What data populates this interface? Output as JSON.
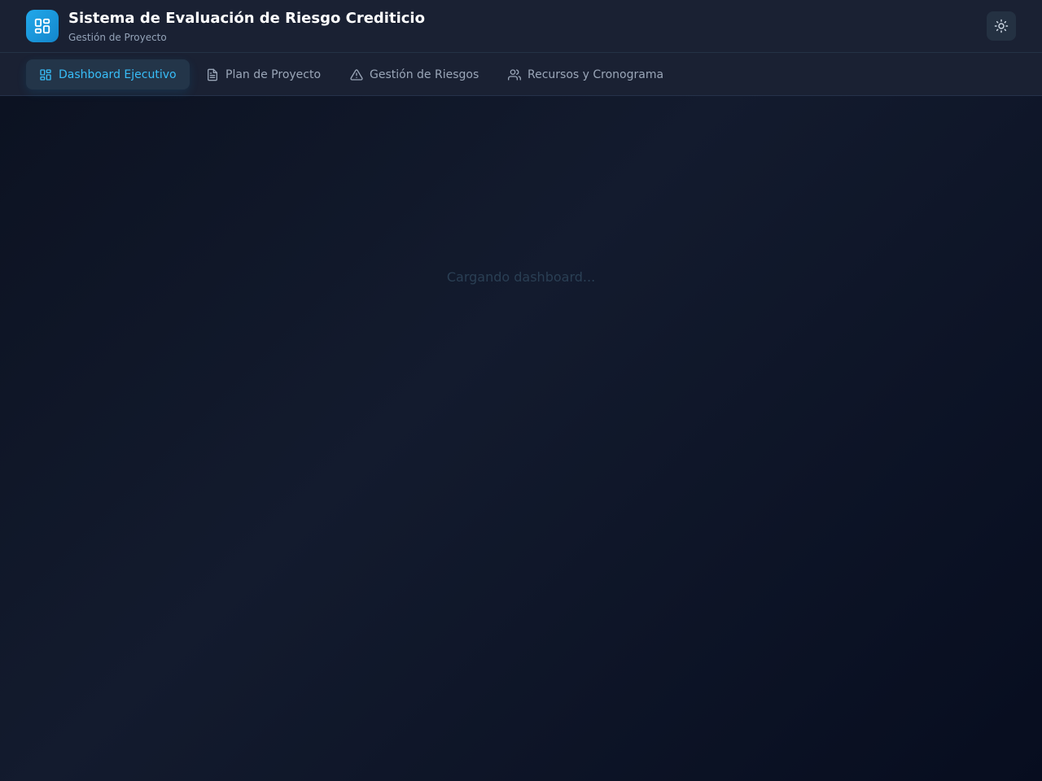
{
  "header": {
    "title": "Sistema de Evaluación de Riesgo Crediticio",
    "subtitle": "Gestión de Proyecto",
    "logo_icon": "dashboard-grid-icon",
    "theme_toggle_icon": "sun-icon"
  },
  "nav": {
    "tabs": [
      {
        "label": "Dashboard Ejecutivo",
        "icon": "layout-grid-icon",
        "active": true
      },
      {
        "label": "Plan de Proyecto",
        "icon": "file-text-icon",
        "active": false
      },
      {
        "label": "Gestión de Riesgos",
        "icon": "alert-triangle-icon",
        "active": false
      },
      {
        "label": "Recursos y Cronograma",
        "icon": "users-icon",
        "active": false
      }
    ]
  },
  "main": {
    "loading_text": "Cargando dashboard..."
  },
  "colors": {
    "accent": "#38bdf8",
    "logo": "#1e9be0",
    "header_bg": "#1a2133",
    "page_bg": "#0b1120"
  }
}
